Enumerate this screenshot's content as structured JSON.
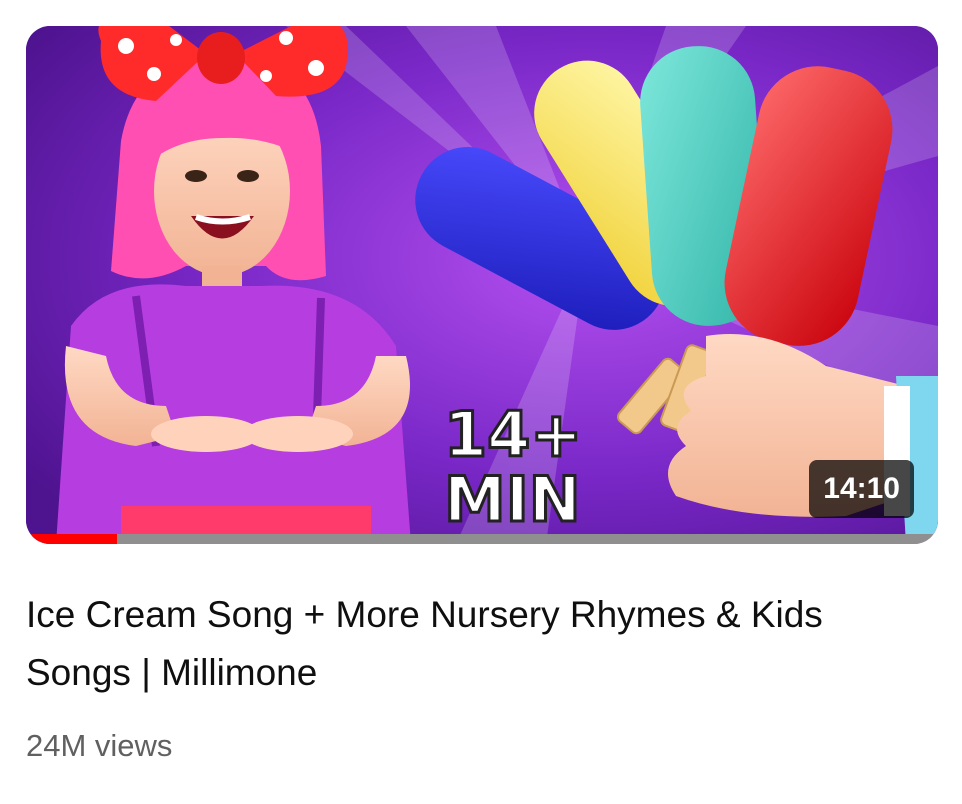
{
  "video": {
    "title": "Ice Cream Song + More Nursery Rhymes & Kids Songs | Millimone",
    "duration": "14:10",
    "views": "24M views",
    "watch_progress_fraction": 0.1,
    "thumbnail": {
      "overlay_text_line1": "14+",
      "overlay_text_line2": "MIN",
      "description_icon": "popsicles-and-singer-thumbnail"
    }
  },
  "colors": {
    "progress_fill": "#ff0000",
    "progress_track": "#8f8f8f",
    "title": "#0f0f0f",
    "meta": "#606060",
    "background": "#ffffff"
  }
}
